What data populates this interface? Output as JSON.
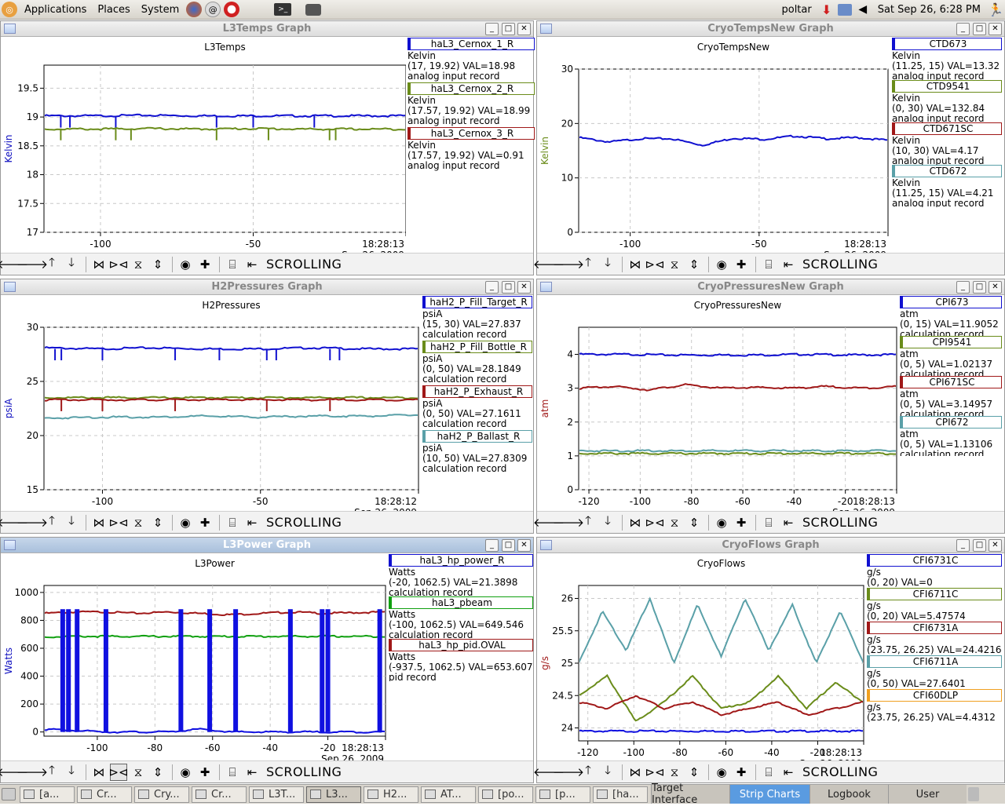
{
  "topbar": {
    "menu": [
      "Applications",
      "Places",
      "System"
    ],
    "user": "poltar",
    "datetime": "Sat Sep 26,  6:28 PM"
  },
  "toolbar": {
    "scrolling_label": "SCROLLING"
  },
  "windows": [
    {
      "id": "l3temps",
      "title": "L3Temps Graph",
      "active": false,
      "chart_data": {
        "type": "line",
        "title": "L3Temps",
        "xlabel": "(Minutes)",
        "ylabel": "Kelvin",
        "ylabel_color": "#1010c0",
        "xlim": [
          -118.5,
          0
        ],
        "ylim": [
          17,
          19.9
        ],
        "yticks": [
          17,
          17.5,
          18,
          18.5,
          19,
          19.5
        ],
        "xticks": [
          -100,
          -50
        ],
        "time_label": [
          "18:28:13",
          "Sep 26, 2009"
        ],
        "series": [
          {
            "name": "haL3_Cernox_1_R",
            "color": "#1010d0",
            "values": [
              19.02,
              19.02,
              19.03,
              19.02,
              19.02,
              19.02,
              19.02,
              19.02
            ],
            "dips": [
              -113,
              -110,
              -95,
              -62,
              -50,
              -30
            ]
          },
          {
            "name": "haL3_Cernox_2_R",
            "color": "#6a8c1a",
            "values": [
              18.79,
              18.79,
              18.8,
              18.79,
              18.8,
              18.79,
              18.79,
              18.79
            ],
            "dips": [
              -113,
              -95,
              -90,
              -62,
              -45,
              -25,
              -23
            ]
          }
        ]
      },
      "legend": [
        {
          "name": "haL3_Cernox_1_R",
          "color": "#1010d0",
          "unit": "Kelvin",
          "range": "(17, 19.92) VAL=18.98",
          "rtype": "analog input record"
        },
        {
          "name": "haL3_Cernox_2_R",
          "color": "#6a8c1a",
          "unit": "Kelvin",
          "range": "(17.57, 19.92) VAL=18.99",
          "rtype": "analog input record"
        },
        {
          "name": "haL3_Cernox_3_R",
          "color": "#a01818",
          "unit": "Kelvin",
          "range": "(17.57, 19.92) VAL=0.91",
          "rtype": "analog input record"
        }
      ]
    },
    {
      "id": "cryotemps",
      "title": "CryoTempsNew Graph",
      "active": false,
      "chart_data": {
        "type": "line",
        "title": "CryoTempsNew",
        "xlabel": "(Minutes)",
        "ylabel": "Kelvin",
        "ylabel_color": "#6a8c1a",
        "xlim": [
          -120,
          0
        ],
        "ylim": [
          0,
          30
        ],
        "yticks": [
          0,
          10,
          20,
          30
        ],
        "xticks": [
          -100,
          -50
        ],
        "time_label": [
          "18:28:13",
          "Sep 26, 2009"
        ],
        "series": [
          {
            "name": "CTD673",
            "color": "#1010d0",
            "values": [
              17.4,
              16.6,
              17.2,
              17.2,
              16.0,
              17.3,
              17.1,
              17.7,
              17.2,
              17.4,
              16.9
            ]
          }
        ]
      },
      "legend": [
        {
          "name": "CTD673",
          "color": "#1010d0",
          "unit": "Kelvin",
          "range": "(11.25, 15) VAL=13.32",
          "rtype": "analog input record"
        },
        {
          "name": "CTD9541",
          "color": "#6a8c1a",
          "unit": "Kelvin",
          "range": "(0, 30) VAL=132.84",
          "rtype": "analog input record"
        },
        {
          "name": "CTD671SC",
          "color": "#a01818",
          "unit": "Kelvin",
          "range": "(10, 30)  VAL=4.17",
          "rtype": "analog input record"
        },
        {
          "name": "CTD672",
          "color": "#5aa0a8",
          "unit": "Kelvin",
          "range": "(11.25, 15) VAL=4.21",
          "rtype": "analog input record"
        }
      ]
    },
    {
      "id": "h2press",
      "title": "H2Pressures Graph",
      "active": false,
      "chart_data": {
        "type": "line",
        "title": "H2Pressures",
        "xlabel": "(Minutes)",
        "ylabel": "psiA",
        "ylabel_color": "#1010c0",
        "xlim": [
          -118.5,
          0
        ],
        "ylim": [
          15,
          30
        ],
        "yticks": [
          15,
          20,
          25,
          30
        ],
        "xticks": [
          -100,
          -50
        ],
        "time_label": [
          "18:28:12",
          "Sep 26, 2009"
        ],
        "series": [
          {
            "name": "haH2_P_Fill_Target_R",
            "color": "#1010d0",
            "values": [
              28.1,
              28.0,
              28.1,
              28.0,
              28.0,
              28.1,
              28.0,
              28.0
            ],
            "dips": [
              -115,
              -113,
              -100,
              -77,
              -63,
              -48,
              -45,
              -28,
              -25
            ]
          },
          {
            "name": "haH2_P_Fill_Bottle_R",
            "color": "#6a8c1a",
            "values": [
              23.5,
              23.5,
              23.5,
              23.5,
              23.5,
              23.5,
              23.5,
              23.5
            ]
          },
          {
            "name": "haH2_P_Exhaust_R",
            "color": "#a01818",
            "values": [
              23.3,
              23.3,
              23.3,
              23.3,
              23.3,
              23.3,
              23.3,
              23.3
            ],
            "dips": [
              -113,
              -100,
              -77,
              -48,
              -28
            ]
          },
          {
            "name": "haH2_P_Ballast_R",
            "color": "#5aa0a8",
            "values": [
              21.6,
              21.7,
              21.7,
              21.8,
              21.7,
              21.8,
              21.8,
              21.9
            ]
          }
        ]
      },
      "legend": [
        {
          "name": "haH2_P_Fill_Target_R",
          "color": "#1010d0",
          "unit": "psiA",
          "range": "(15, 30) VAL=27.837",
          "rtype": "calculation record"
        },
        {
          "name": "haH2_P_Fill_Bottle_R",
          "color": "#6a8c1a",
          "unit": "psiA",
          "range": "(0, 50) VAL=28.1849",
          "rtype": "calculation record"
        },
        {
          "name": "haH2_P_Exhaust_R",
          "color": "#a01818",
          "unit": "psiA",
          "range": "(0, 50) VAL=27.1611",
          "rtype": "calculation record"
        },
        {
          "name": "haH2_P_Ballast_R",
          "color": "#5aa0a8",
          "unit": "psiA",
          "range": "(10, 50) VAL=27.8309",
          "rtype": "calculation record"
        }
      ]
    },
    {
      "id": "cryopress",
      "title": "CryoPressuresNew Graph",
      "active": false,
      "chart_data": {
        "type": "line",
        "title": "CryoPressuresNew",
        "xlabel": "(Minutes)",
        "ylabel": "atm",
        "ylabel_color": "#a01818",
        "xlim": [
          -124,
          0
        ],
        "ylim": [
          0,
          4.8
        ],
        "yticks": [
          0,
          1,
          2,
          3,
          4
        ],
        "xticks": [
          -120,
          -100,
          -80,
          -60,
          -40,
          -20
        ],
        "time_label": [
          "18:28:13",
          "Sep 26, 2009"
        ],
        "series": [
          {
            "name": "CPI673",
            "color": "#1010d0",
            "values": [
              4.0,
              4.0,
              3.98,
              3.98,
              3.98,
              4.0,
              3.98,
              3.99
            ]
          },
          {
            "name": "CPI9541",
            "color": "#6a8c1a",
            "values": [
              1.07,
              1.07,
              1.07,
              1.07,
              1.07,
              1.07,
              1.07,
              1.07
            ]
          },
          {
            "name": "CPI671SC",
            "color": "#a01818",
            "values": [
              3.0,
              3.05,
              2.95,
              3.1,
              3.0,
              3.02,
              3.0,
              3.05,
              3.0,
              3.05
            ]
          },
          {
            "name": "CPI672",
            "color": "#5aa0a8",
            "values": [
              1.15,
              1.15,
              1.15,
              1.15,
              1.15,
              1.15,
              1.15,
              1.15
            ]
          }
        ]
      },
      "legend": [
        {
          "name": "CPI673",
          "color": "#1010d0",
          "unit": "atm",
          "range": "(0, 15) VAL=11.9052",
          "rtype": "calculation record"
        },
        {
          "name": "CPI9541",
          "color": "#6a8c1a",
          "unit": "atm",
          "range": "(0, 5) VAL=1.02137",
          "rtype": "calculation record"
        },
        {
          "name": "CPI671SC",
          "color": "#a01818",
          "unit": "atm",
          "range": "(0, 5) VAL=3.14957",
          "rtype": "calculation record"
        },
        {
          "name": "CPI672",
          "color": "#5aa0a8",
          "unit": "atm",
          "range": "(0, 5) VAL=1.13106",
          "rtype": "calculation record"
        }
      ]
    },
    {
      "id": "l3power",
      "title": "L3Power Graph",
      "active": true,
      "chart_data": {
        "type": "line",
        "title": "L3Power",
        "xlabel": "(Minutes)",
        "ylabel": "Watts",
        "ylabel_color": "#1010c0",
        "xlim": [
          -118.5,
          0
        ],
        "ylim": [
          -30,
          1050
        ],
        "yticks": [
          0,
          200,
          400,
          600,
          800,
          1000
        ],
        "xticks": [
          -100,
          -80,
          -60,
          -40,
          -20
        ],
        "time_label": [
          "18:28:13",
          "Sep 26, 2009"
        ],
        "series": [
          {
            "name": "haL3_hp_power_R",
            "color": "#a01818",
            "values": [
              850,
              860,
              860,
              850,
              860,
              850,
              840,
              850,
              860,
              850,
              855,
              860
            ]
          },
          {
            "name": "haL3_pbeam",
            "color": "#10a010",
            "values": [
              680,
              685,
              685,
              685,
              685,
              685,
              685,
              685,
              685,
              685,
              685,
              685
            ]
          },
          {
            "name": "haL3_hp_pid.OVAL",
            "color": "#1010e0",
            "values": [
              20,
              10,
              0,
              0,
              0,
              20,
              0,
              0,
              0,
              0,
              0,
              0
            ],
            "spikes": [
              -112,
              -110,
              -107,
              -97,
              -71,
              -61,
              -52,
              -33,
              -22,
              -20,
              -2
            ]
          }
        ]
      },
      "legend": [
        {
          "name": "haL3_hp_power_R",
          "color": "#1010d0",
          "unit": "Watts",
          "range": "(-20, 1062.5) VAL=21.3898",
          "rtype": "calculation record"
        },
        {
          "name": "haL3_pbeam",
          "color": "#10a010",
          "unit": "Watts",
          "range": "(-100, 1062.5) VAL=649.546",
          "rtype": "calculation record"
        },
        {
          "name": "haL3_hp_pid.OVAL",
          "color": "#a01818",
          "unit": "Watts",
          "range": "(-937.5, 1062.5) VAL=653.607",
          "rtype": "pid record"
        }
      ]
    },
    {
      "id": "cryoflows",
      "title": "CryoFlows Graph",
      "active": false,
      "chart_data": {
        "type": "line",
        "title": "CryoFlows",
        "xlabel": "(Minutes)",
        "ylabel": "g/s",
        "ylabel_color": "#a01818",
        "xlim": [
          -124,
          0
        ],
        "ylim": [
          23.8,
          26.2
        ],
        "yticks": [
          24,
          24.5,
          25,
          25.5,
          26
        ],
        "xticks": [
          -120,
          -100,
          -80,
          -60,
          -40,
          -20
        ],
        "time_label": [
          "18:28:13",
          "Sep 26, 2009"
        ],
        "series": [
          {
            "name": "CFI6731C",
            "color": "#1010e0",
            "values": [
              23.95,
              23.95,
              23.95,
              23.95,
              23.95,
              23.95,
              23.95,
              23.95
            ]
          },
          {
            "name": "CFI6711C",
            "color": "#6a8c1a",
            "values": [
              24.5,
              24.8,
              24.1,
              24.4,
              24.8,
              24.3,
              24.4,
              24.8,
              24.3,
              24.7,
              24.4
            ]
          },
          {
            "name": "CFI6731A",
            "color": "#a01818",
            "values": [
              24.4,
              24.3,
              24.5,
              24.3,
              24.4,
              24.2,
              24.3,
              24.4,
              24.2,
              24.3,
              24.4
            ]
          },
          {
            "name": "CFI6711A",
            "color": "#5aa0a8",
            "values": [
              25.0,
              25.8,
              25.2,
              26.0,
              25.0,
              25.9,
              25.1,
              26.0,
              25.2,
              25.9,
              25.0,
              25.8,
              25.0
            ]
          }
        ]
      },
      "legend": [
        {
          "name": "CFI6731C",
          "color": "#1010d0",
          "unit": "g/s",
          "range": "(0, 20) VAL=0",
          "rtype": ""
        },
        {
          "name": "CFI6711C",
          "color": "#6a8c1a",
          "unit": "g/s",
          "range": "(0, 20) VAL=5.47574",
          "rtype": ""
        },
        {
          "name": "CFI6731A",
          "color": "#a01818",
          "unit": "g/s",
          "range": "(23.75, 26.25) VAL=24.4216",
          "rtype": ""
        },
        {
          "name": "CFI6711A",
          "color": "#5aa0a8",
          "unit": "g/s",
          "range": "(0, 50) VAL=27.6401",
          "rtype": ""
        },
        {
          "name": "CFI60DLP",
          "color": "#f0a020",
          "unit": "g/s",
          "range": "(23.75, 26.25) VAL=4.4312",
          "rtype": ""
        }
      ]
    }
  ],
  "taskbar": {
    "tasks": [
      "[a...",
      "Cr...",
      "Cry...",
      "Cr...",
      "L3T...",
      "L3...",
      "H2...",
      "AT...",
      "[po...",
      "[p...",
      "[ha..."
    ],
    "panel_tabs": [
      {
        "label": "Target Interface",
        "active": false
      },
      {
        "label": "Strip Charts",
        "active": true
      },
      {
        "label": "Logbook",
        "active": false
      },
      {
        "label": "User",
        "active": false
      }
    ]
  }
}
